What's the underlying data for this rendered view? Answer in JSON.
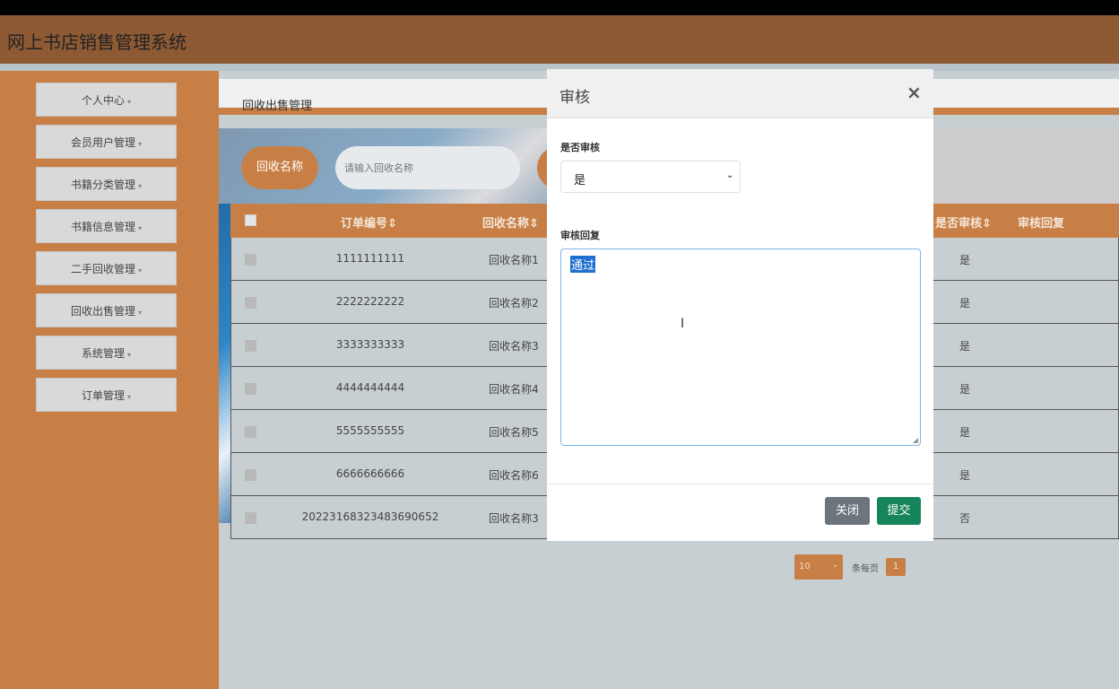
{
  "app": {
    "title": "网上书店销售管理系统"
  },
  "sidebar": {
    "items": [
      {
        "label": "个人中心"
      },
      {
        "label": "会员用户管理"
      },
      {
        "label": "书籍分类管理"
      },
      {
        "label": "书籍信息管理"
      },
      {
        "label": "二手回收管理"
      },
      {
        "label": "回收出售管理"
      },
      {
        "label": "系统管理"
      },
      {
        "label": "订单管理"
      }
    ],
    "caret": "▾"
  },
  "breadcrumb": {
    "label": "回收出售管理"
  },
  "search": {
    "label": "回收名称",
    "placeholder": "请输入回收名称"
  },
  "table": {
    "headers": {
      "order_no": "订单编号",
      "name": "回收名称",
      "audit": "是否审核",
      "reply": "审核回复"
    },
    "sort_icon": "⇕",
    "rows": [
      {
        "order_no": "1111111111",
        "name": "回收名称1",
        "audit": "是"
      },
      {
        "order_no": "2222222222",
        "name": "回收名称2",
        "audit": "是"
      },
      {
        "order_no": "3333333333",
        "name": "回收名称3",
        "audit": "是"
      },
      {
        "order_no": "4444444444",
        "name": "回收名称4",
        "audit": "是"
      },
      {
        "order_no": "5555555555",
        "name": "回收名称5",
        "audit": "是"
      },
      {
        "order_no": "6666666666",
        "name": "回收名称6",
        "audit": "是"
      },
      {
        "order_no": "20223168323483690652",
        "name": "回收名称3",
        "audit": "否"
      }
    ]
  },
  "pager": {
    "page_size": "10",
    "per_page_label": "条每页",
    "current_page": "1"
  },
  "modal": {
    "title": "审核",
    "close_glyph": "×",
    "audit_label": "是否审核",
    "audit_value": "是",
    "reply_label": "审核回复",
    "reply_value": "通过",
    "close_button": "关闭",
    "submit_button": "提交"
  }
}
